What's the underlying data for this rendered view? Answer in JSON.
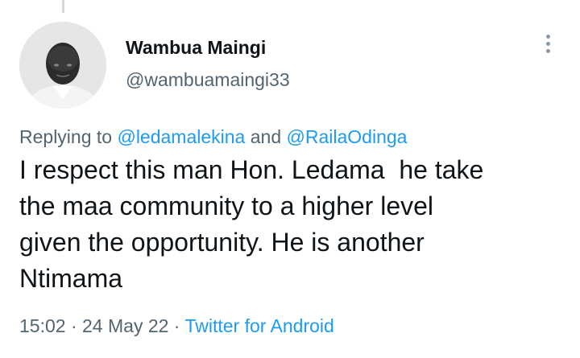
{
  "tweet": {
    "author": {
      "display_name": "Wambua Maingi",
      "handle": "@wambuamaingi33"
    },
    "more_icon": "three-dots-vertical-icon",
    "replying": {
      "prefix": "Replying to ",
      "user1": "@ledamalekina",
      "conjunction": " and ",
      "user2": "@RailaOdinga"
    },
    "text_lines": [
      "I respect this man Hon. Ledama  he take",
      "the maa community to a higher level",
      "given the opportunity. He is another",
      "Ntimama"
    ],
    "time": "15:02",
    "separator": " · ",
    "date": "24 May 22",
    "source": "Twitter for Android",
    "colors": {
      "link": "#1d9bf0",
      "secondary_text": "#536471",
      "primary_text": "#0f1419"
    }
  }
}
